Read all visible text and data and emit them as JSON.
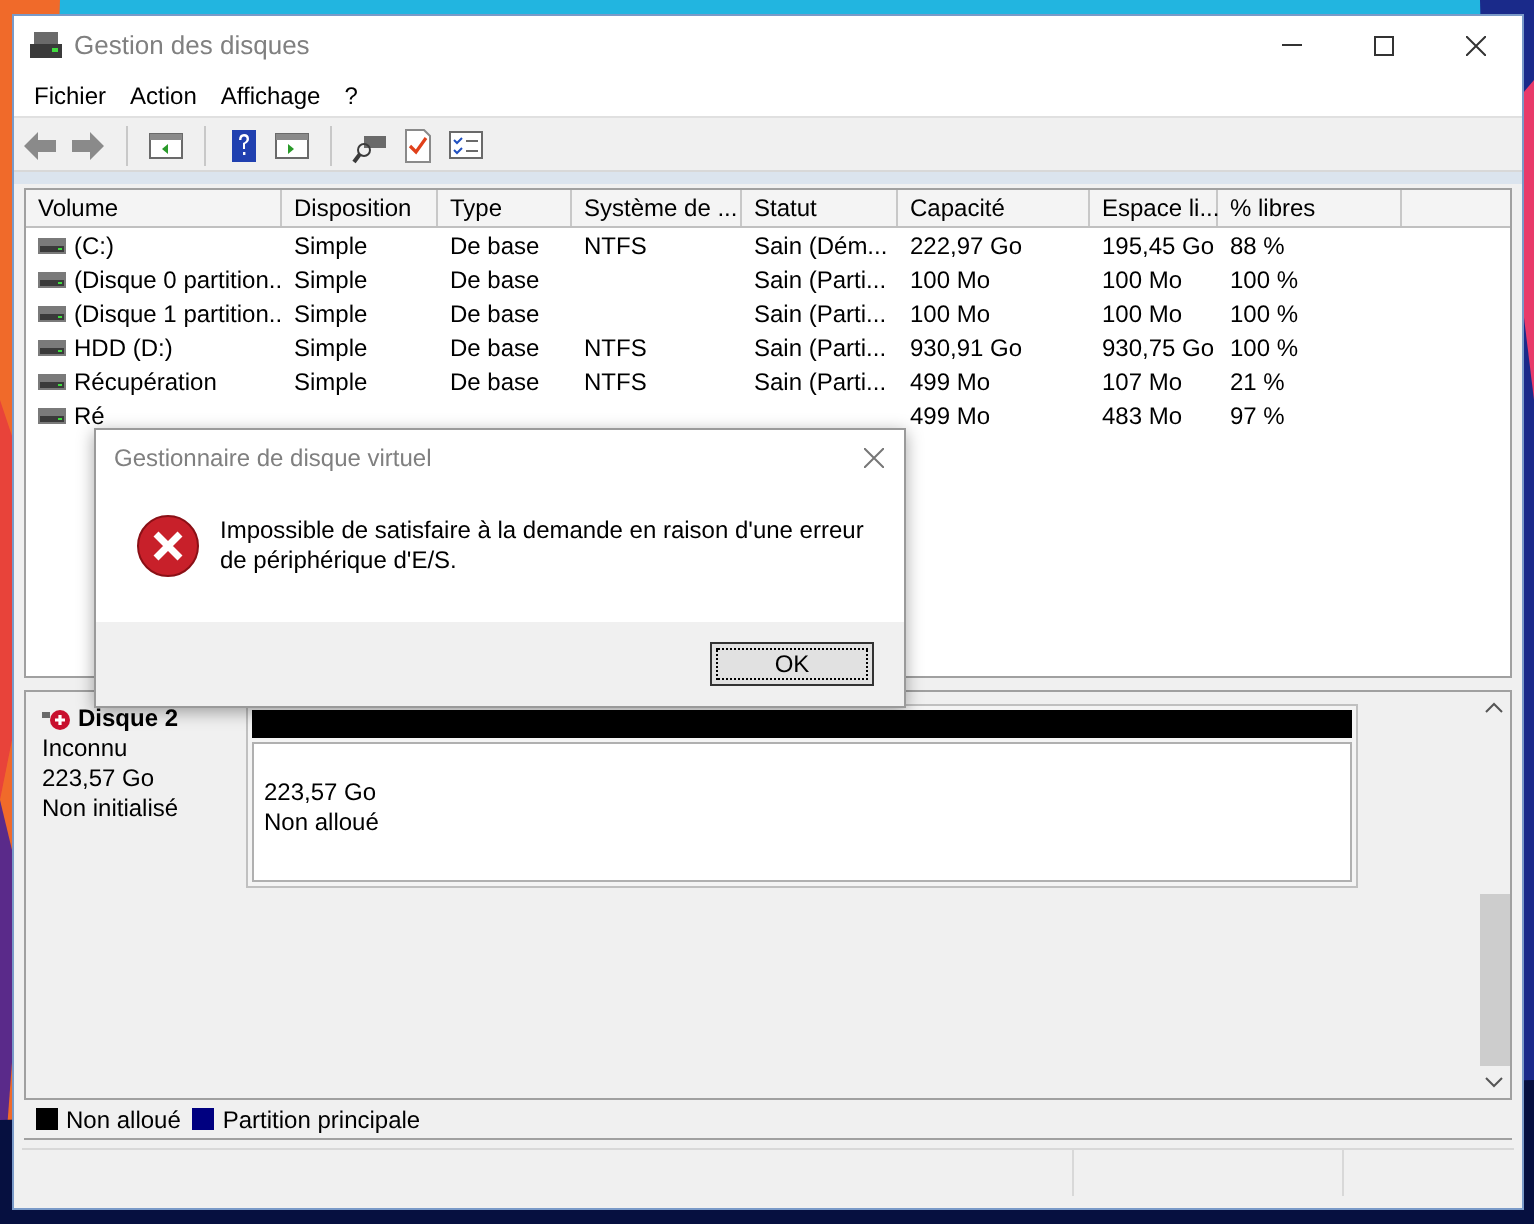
{
  "window": {
    "title": "Gestion des disques"
  },
  "menu": [
    "Fichier",
    "Action",
    "Affichage",
    "?"
  ],
  "table": {
    "columns": [
      "Volume",
      "Disposition",
      "Type",
      "Système de ...",
      "Statut",
      "Capacité",
      "Espace li...",
      "% libres"
    ],
    "rows": [
      [
        "(C:)",
        "Simple",
        "De base",
        "NTFS",
        "Sain (Dém...",
        "222,97 Go",
        "195,45 Go",
        "88 %"
      ],
      [
        "(Disque 0 partition...",
        "Simple",
        "De base",
        "",
        "Sain (Parti...",
        "100 Mo",
        "100 Mo",
        "100 %"
      ],
      [
        "(Disque 1 partition...",
        "Simple",
        "De base",
        "",
        "Sain (Parti...",
        "100 Mo",
        "100 Mo",
        "100 %"
      ],
      [
        "HDD (D:)",
        "Simple",
        "De base",
        "NTFS",
        "Sain (Parti...",
        "930,91 Go",
        "930,75 Go",
        "100 %"
      ],
      [
        "Récupération",
        "Simple",
        "De base",
        "NTFS",
        "Sain (Parti...",
        "499 Mo",
        "107 Mo",
        "21 %"
      ],
      [
        "Ré",
        "",
        "",
        "",
        "",
        "499 Mo",
        "483 Mo",
        "97 %"
      ]
    ]
  },
  "disk": {
    "name": "Disque 2",
    "type": "Inconnu",
    "size": "223,57 Go",
    "state": "Non initialisé",
    "partition": {
      "size": "223,57 Go",
      "label": "Non alloué",
      "color": "#000000"
    }
  },
  "legend": [
    {
      "label": "Non alloué",
      "color": "#000000"
    },
    {
      "label": "Partition principale",
      "color": "#000080"
    }
  ],
  "dialog": {
    "title": "Gestionnaire de disque virtuel",
    "message": "Impossible de satisfaire à la demande en raison d'une erreur de périphérique d'E/S.",
    "button": "OK"
  }
}
